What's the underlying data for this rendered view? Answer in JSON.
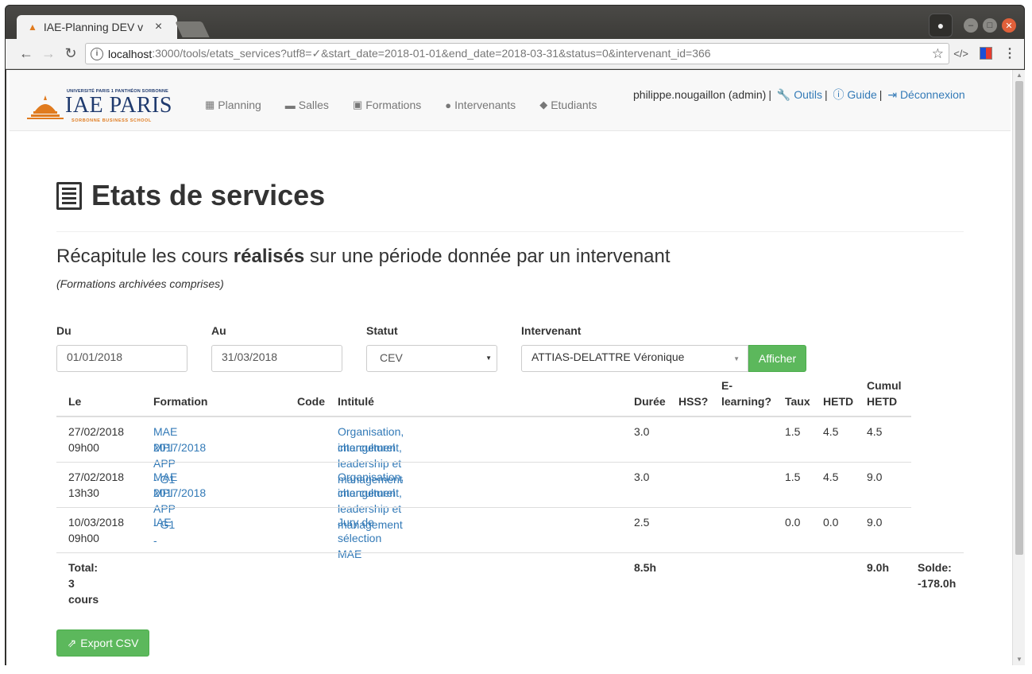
{
  "browser": {
    "tab_title": "IAE-Planning DEV v",
    "tab_close": "×",
    "url_host": "localhost",
    "url_path": ":3000/tools/etats_services?utf8=✓&start_date=2018-01-01&end_date=2018-03-31&status=0&intervenant_id=366"
  },
  "navbar": {
    "logo_top": "UNIVERSITÉ PARIS 1 PANTHÉON SORBONNE",
    "logo_main": "IAE PARIS",
    "logo_sub": "SORBONNE BUSINESS SCHOOL",
    "items": [
      {
        "label": "Planning",
        "icon": "calendar-icon"
      },
      {
        "label": "Salles",
        "icon": "desk-icon"
      },
      {
        "label": "Formations",
        "icon": "briefcase-icon"
      },
      {
        "label": "Intervenants",
        "icon": "user-icon"
      },
      {
        "label": "Etudiants",
        "icon": "graduation-cap-icon"
      }
    ],
    "user": "philippe.nougaillon (admin)",
    "outils": "Outils",
    "guide": "Guide",
    "logout": "Déconnexion"
  },
  "page": {
    "title": "Etats de services",
    "subtitle_pre": "Récapitule les cours ",
    "subtitle_bold": "réalisés",
    "subtitle_post": " sur une période donnée par un intervenant",
    "note": "(Formations archivées comprises)"
  },
  "form": {
    "du_label": "Du",
    "du_value": "01/01/2018",
    "au_label": "Au",
    "au_value": "31/03/2018",
    "statut_label": "Statut",
    "statut_value": "CEV",
    "intervenant_label": "Intervenant",
    "intervenant_value": "ATTIAS-DELATTRE Véronique",
    "submit": "Afficher"
  },
  "table": {
    "headers": {
      "le": "Le",
      "formation": "Formation",
      "code": "Code",
      "intitule": "Intitulé",
      "duree": "Durée",
      "hss": "HSS?",
      "elearning_1": "E-",
      "elearning_2": "learning?",
      "taux": "Taux",
      "hetd": "HETD",
      "cumul_1": "Cumul",
      "cumul_2": "HETD"
    },
    "rows": [
      {
        "date": "27/02/2018",
        "time": "09h00",
        "formation_1": "MAE MPI APP - G1 -",
        "formation_2": "2017/2018",
        "intitule_1": "Organisation, changement, leadership et management",
        "intitule_2": "interculturel",
        "duree": "3.0",
        "taux": "1.5",
        "hetd": "4.5",
        "cumul": "4.5"
      },
      {
        "date": "27/02/2018",
        "time": "13h30",
        "formation_1": "MAE MPI APP - G1 -",
        "formation_2": "2017/2018",
        "intitule_1": "Organisation, changement, leadership et management",
        "intitule_2": "interculturel",
        "duree": "3.0",
        "taux": "1.5",
        "hetd": "4.5",
        "cumul": "9.0"
      },
      {
        "date": "10/03/2018",
        "time": "09h00",
        "formation_1": "IAE",
        "formation_2": "",
        "intitule_1": "Jury de sélection MAE",
        "intitule_2": "",
        "duree": "2.5",
        "taux": "0.0",
        "hetd": "0.0",
        "cumul": "9.0"
      }
    ],
    "total": {
      "label": "Total: 3 cours",
      "duree": "8.5h",
      "cumul": "9.0h",
      "solde_1": "Solde:",
      "solde_2": "-178.0h"
    }
  },
  "export": {
    "label": "Export CSV"
  }
}
